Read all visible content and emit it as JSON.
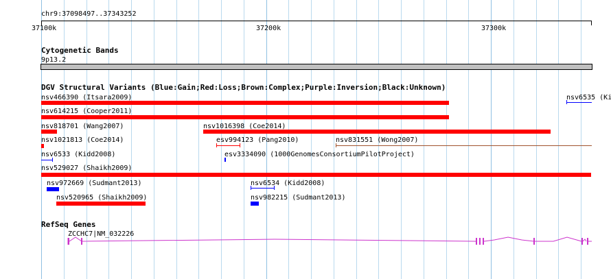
{
  "ruler": {
    "location": "chr9:37098497..37343252",
    "labels": [
      "37100k",
      "37200k",
      "37300k"
    ]
  },
  "cytoband": {
    "title": "Cytogenetic Bands",
    "band": "9p13.2"
  },
  "dgv": {
    "title": "DGV Structural Variants (Blue:Gain;Red:Loss;Brown:Complex;Purple:Inversion;Black:Unknown)",
    "variants": [
      {
        "label": "nsv466390 (Itsara2009)",
        "color": "red"
      },
      {
        "label": "nsv6535 (Ki",
        "color": "blue"
      },
      {
        "label": "nsv614215 (Cooper2011)",
        "color": "red"
      },
      {
        "label": "nsv818701 (Wang2007)",
        "color": "red"
      },
      {
        "label": "nsv1016398 (Coe2014)",
        "color": "red"
      },
      {
        "label": "nsv1021813 (Coe2014)",
        "color": "red"
      },
      {
        "label": "esv994123 (Pang2010)",
        "color": "red"
      },
      {
        "label": "nsv831551 (Wong2007)",
        "color": "brown"
      },
      {
        "label": "nsv6533 (Kidd2008)",
        "color": "blue"
      },
      {
        "label": "esv3334090 (1000GenomesConsortiumPilotProject)",
        "color": "blue"
      },
      {
        "label": "nsv529027 (Shaikh2009)",
        "color": "red"
      },
      {
        "label": "nsv972669 (Sudmant2013)",
        "color": "blue"
      },
      {
        "label": "nsv6534 (Kidd2008)",
        "color": "blue"
      },
      {
        "label": "nsv520965 (Shaikh2009)",
        "color": "red"
      },
      {
        "label": "nsv982215 (Sudmant2013)",
        "color": "blue"
      }
    ]
  },
  "refseq": {
    "title": "RefSeq Genes",
    "gene_label": "ZCCHC7|NM_032226"
  },
  "colors": {
    "gain": "#0000ff",
    "loss": "#ff0000",
    "complex": "#a0522d",
    "gene": "#cc33cc",
    "grid": "#b9d9ee",
    "band": "#c0c0c0"
  }
}
